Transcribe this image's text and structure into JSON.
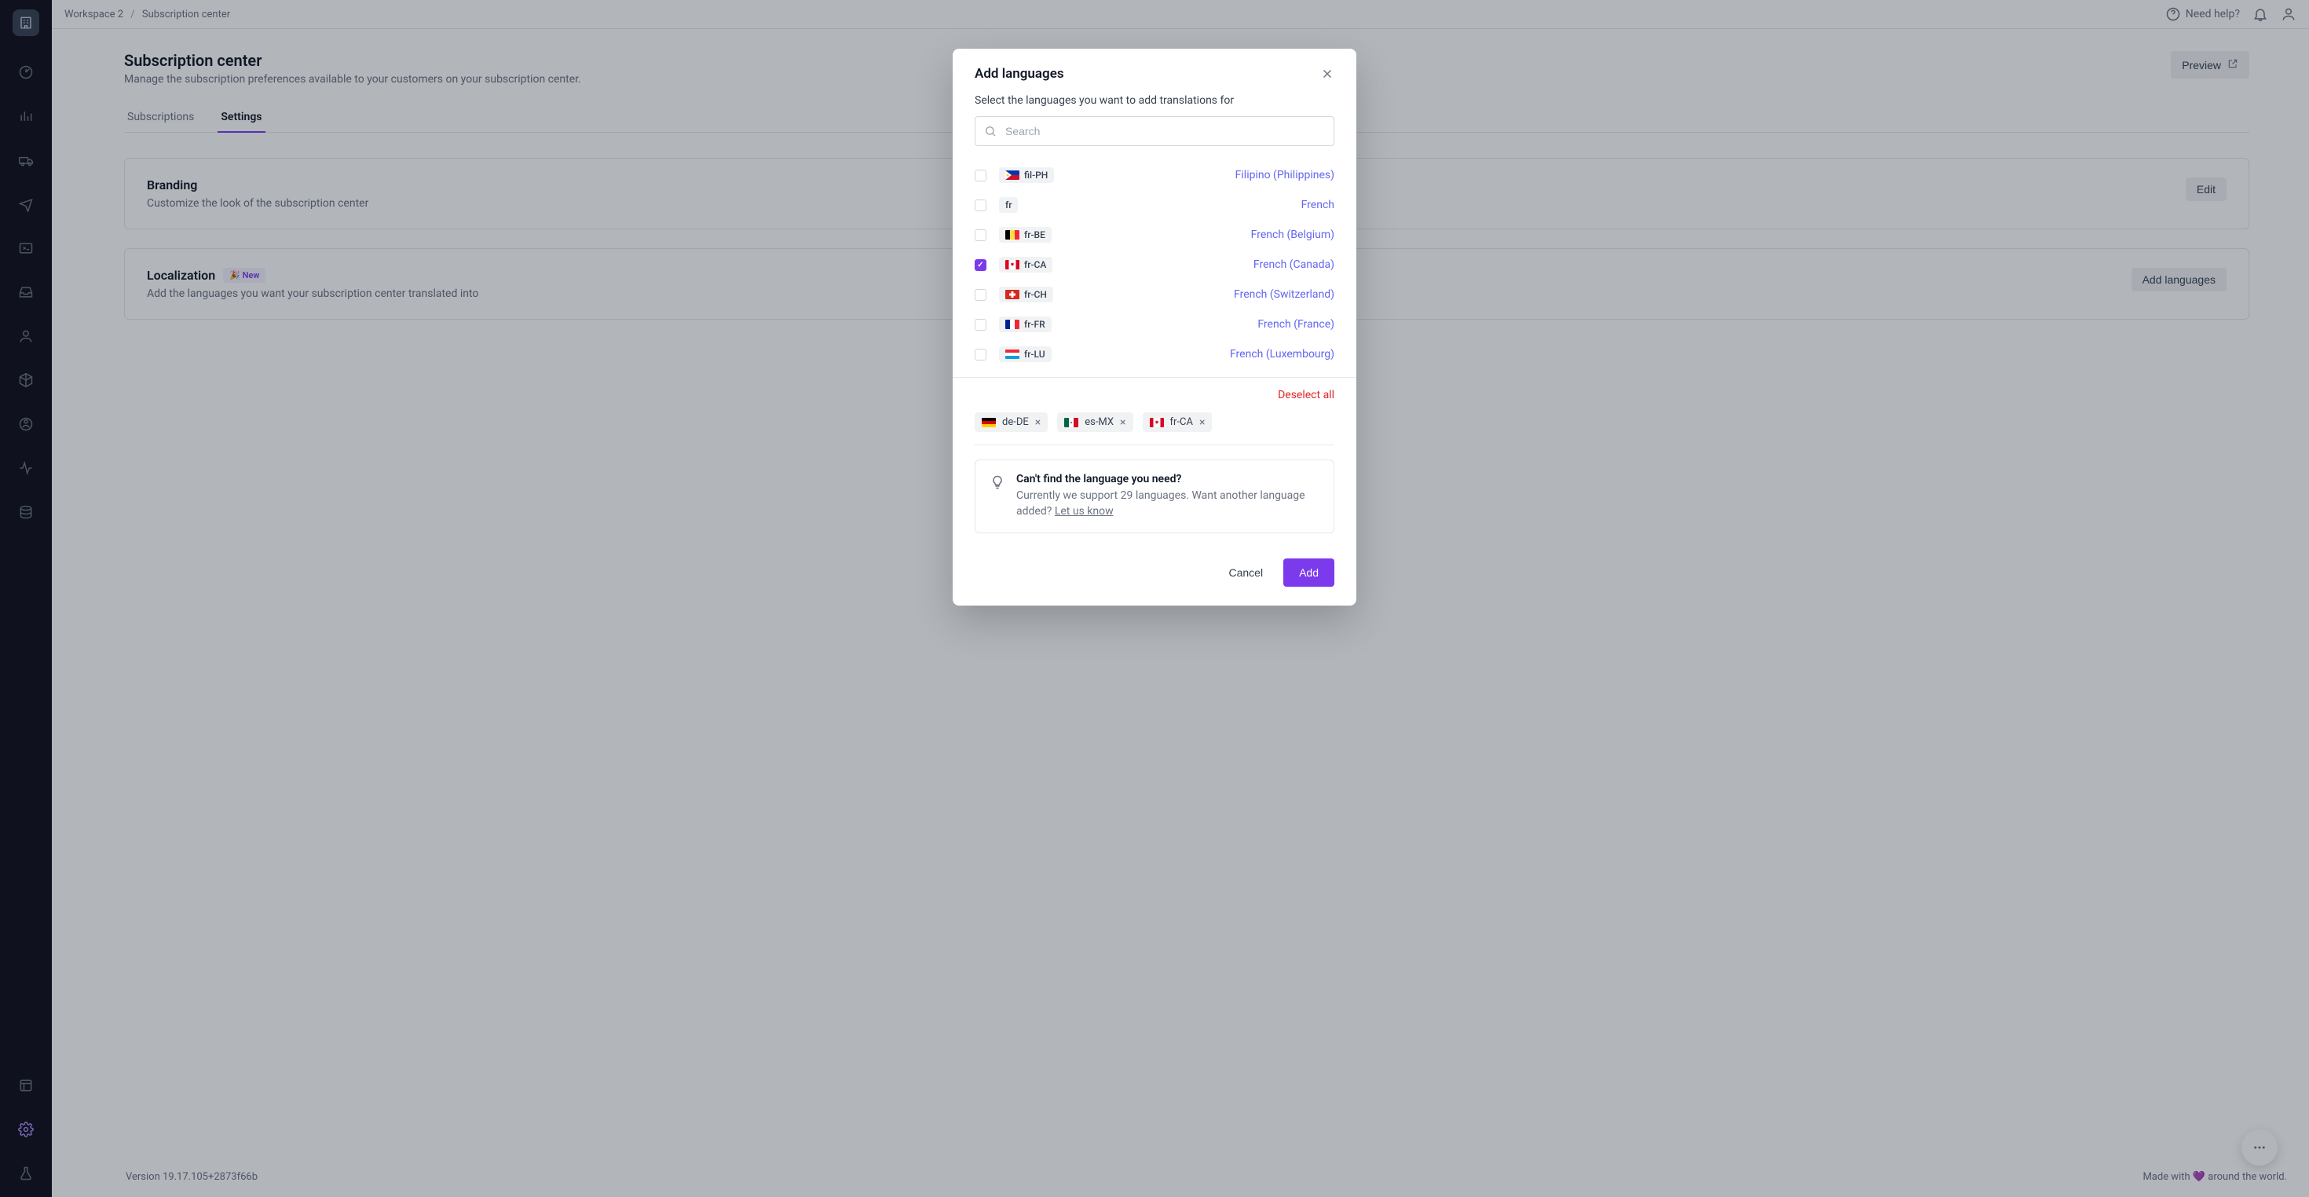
{
  "breadcrumb": {
    "workspace": "Workspace 2",
    "page": "Subscription center"
  },
  "topbar": {
    "help": "Need help?"
  },
  "page": {
    "title": "Subscription center",
    "subtitle": "Manage the subscription preferences available to your customers on your subscription center.",
    "preview_label": "Preview"
  },
  "tabs": {
    "subscriptions": "Subscriptions",
    "settings": "Settings"
  },
  "cards": {
    "branding": {
      "title": "Branding",
      "subtitle": "Customize the look of the subscription center",
      "button": "Edit"
    },
    "localization": {
      "title": "Localization",
      "badge": "🎉 New",
      "subtitle": "Add the languages you want your subscription center translated into",
      "button": "Add languages"
    }
  },
  "footer": {
    "version": "Version 19.17.105+2873f66b",
    "tagline": "Made with 💜 around the world."
  },
  "modal": {
    "title": "Add languages",
    "description": "Select the languages you want to add translations for",
    "search_placeholder": "Search",
    "languages": [
      {
        "code": "fil-PH",
        "name": "Filipino (Philippines)",
        "checked": false,
        "flag": "ph"
      },
      {
        "code": "fr",
        "name": "French",
        "checked": false,
        "flag": ""
      },
      {
        "code": "fr-BE",
        "name": "French (Belgium)",
        "checked": false,
        "flag": "be"
      },
      {
        "code": "fr-CA",
        "name": "French (Canada)",
        "checked": true,
        "flag": "ca"
      },
      {
        "code": "fr-CH",
        "name": "French (Switzerland)",
        "checked": false,
        "flag": "ch"
      },
      {
        "code": "fr-FR",
        "name": "French (France)",
        "checked": false,
        "flag": "fr"
      },
      {
        "code": "fr-LU",
        "name": "French (Luxembourg)",
        "checked": false,
        "flag": "lu"
      }
    ],
    "deselect": "Deselect all",
    "selected": [
      {
        "code": "de-DE",
        "flag": "de"
      },
      {
        "code": "es-MX",
        "flag": "mx"
      },
      {
        "code": "fr-CA",
        "flag": "ca"
      }
    ],
    "info": {
      "title": "Can't find the language you need?",
      "text": "Currently we support 29 languages. Want another language added? ",
      "link": "Let us know"
    },
    "cancel": "Cancel",
    "add": "Add"
  }
}
